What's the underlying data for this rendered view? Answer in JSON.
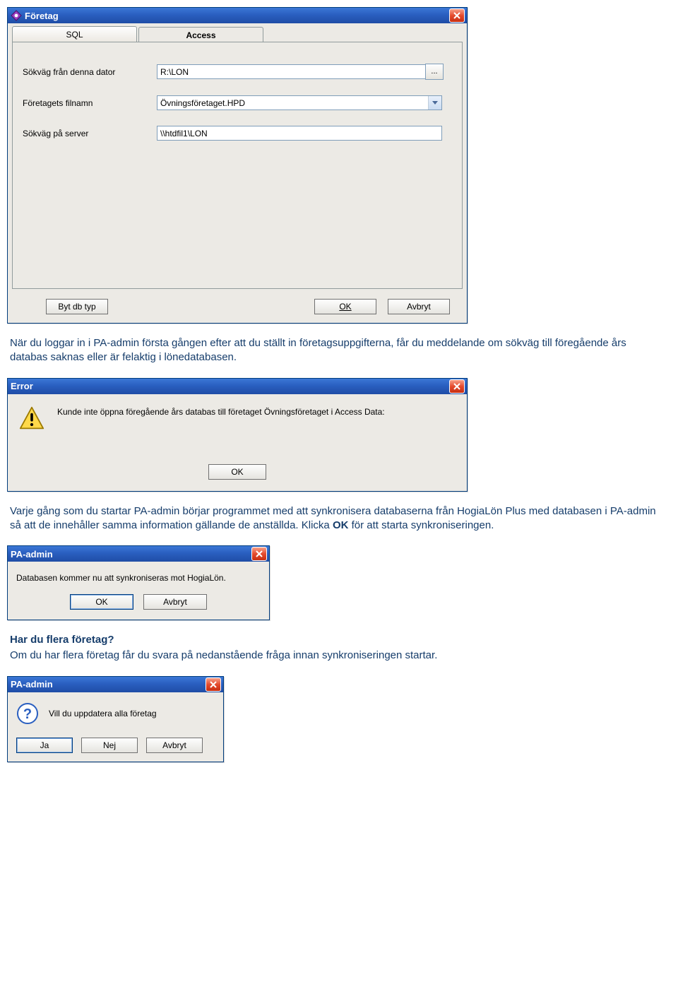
{
  "foretag": {
    "title": "Företag",
    "tabs": {
      "sql": "SQL",
      "access": "Access"
    },
    "labels": {
      "path_label": "Sökväg från denna dator",
      "filename_label": "Företagets filnamn",
      "server_label": "Sökväg på server"
    },
    "values": {
      "path": "R:\\LON",
      "filename": "Övningsföretaget.HPD",
      "server": "\\\\htdfil1\\LON"
    },
    "browse": "...",
    "buttons": {
      "change_db": "Byt db typ",
      "ok": "OK",
      "cancel": "Avbryt"
    }
  },
  "para1": "När du loggar in i PA-admin första gången efter att du ställt in företagsuppgifterna, får du meddelande om sökväg till föregående års databas saknas eller är felaktig i lönedatabasen.",
  "error": {
    "title": "Error",
    "message": "Kunde inte öppna föregående års databas till företaget Övningsföretaget i Access  Data:",
    "ok": "OK"
  },
  "para2_a": "Varje gång som du startar PA-admin börjar programmet med att synkronisera databaserna från HogiaLön Plus med databasen i PA-admin så att de innehåller samma information gällande de anställda. Klicka ",
  "para2_bold": "OK",
  "para2_b": " för att starta synkroniseringen.",
  "pa_sync": {
    "title": "PA-admin",
    "message": "Databasen kommer nu att synkroniseras mot HogiaLön.",
    "ok": "OK",
    "cancel": "Avbryt"
  },
  "heading3": "Har du flera företag?",
  "para3": "Om du har flera företag får du svara på nedanstående fråga innan synkroniseringen startar.",
  "pa_q": {
    "title": "PA-admin",
    "message": "Vill du uppdatera alla företag",
    "yes": "Ja",
    "no": "Nej",
    "cancel": "Avbryt"
  }
}
